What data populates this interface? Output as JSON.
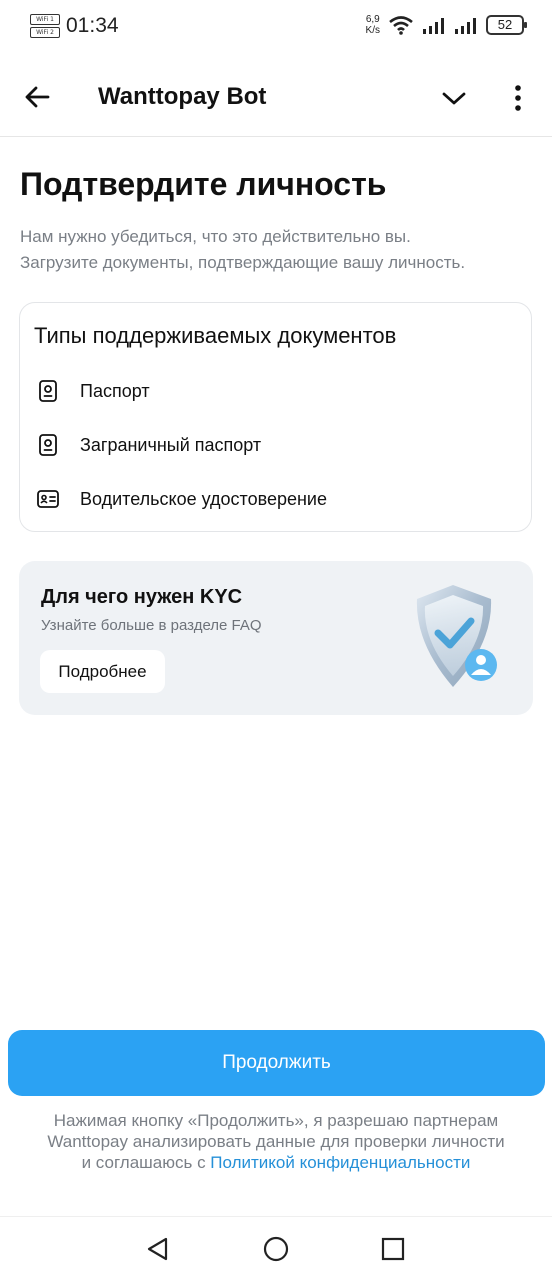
{
  "status_bar": {
    "time": "01:34",
    "wifi_tag_1": "WiFi 1",
    "wifi_tag_2": "WiFi 2",
    "speed_value": "6,9",
    "speed_unit": "K/s",
    "battery": "52"
  },
  "header": {
    "title": "Wanttopay Bot"
  },
  "main": {
    "heading": "Подтвердите личность",
    "description_line1": "Нам нужно убедиться, что это действительно вы.",
    "description_line2": "Загрузите документы, подтверждающие вашу личность."
  },
  "documents": {
    "title": "Типы поддерживаемых документов",
    "items": [
      {
        "label": "Паспорт",
        "icon": "passport-icon"
      },
      {
        "label": "Заграничный паспорт",
        "icon": "passport-icon"
      },
      {
        "label": "Водительское удостоверение",
        "icon": "id-card-icon"
      }
    ]
  },
  "kyc": {
    "title": "Для чего нужен KYC",
    "subtitle": "Узнайте больше в разделе FAQ",
    "button": "Подробнее",
    "illustration": "shield-user-icon"
  },
  "footer": {
    "continue_button": "Продолжить",
    "legal_line1": "Нажимая кнопку «Продолжить», я разрешаю партнерам",
    "legal_line2": "Wanttopay анализировать данные для проверки личности",
    "legal_line3_prefix": "и соглашаюсь с ",
    "legal_link": "Политикой конфиденциальности"
  },
  "colors": {
    "accent": "#2ba2f3",
    "link": "#2590d8",
    "muted_text": "#7a7f86",
    "card_bg": "#eff2f5"
  }
}
